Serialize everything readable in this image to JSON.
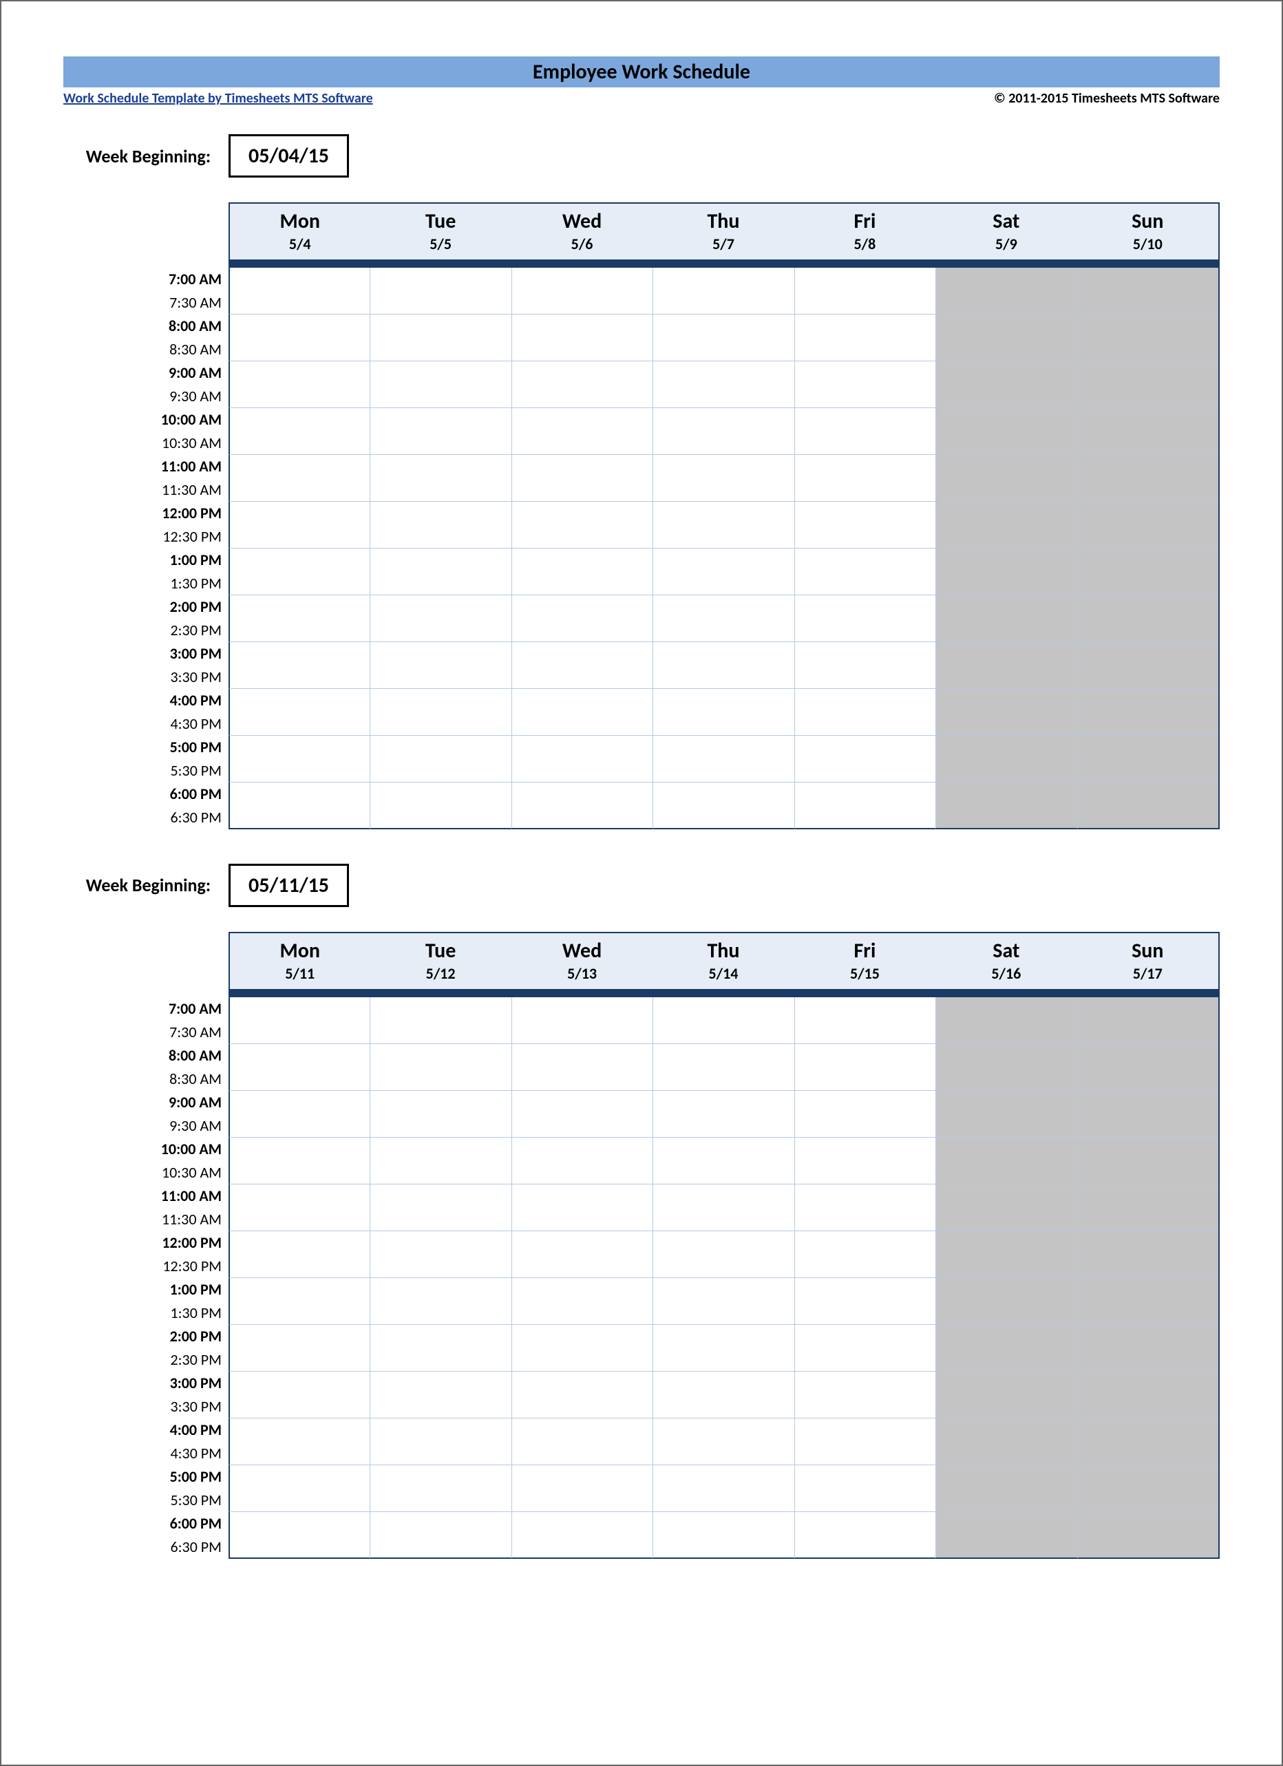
{
  "header": {
    "title": "Employee Work Schedule",
    "link_text": "Work Schedule Template by Timesheets MTS Software",
    "copyright": "© 2011-2015 Timesheets MTS Software"
  },
  "week_begin_label": "Week Beginning:",
  "weeks": [
    {
      "date": "05/04/15",
      "days": [
        {
          "name": "Mon",
          "date": "5/4",
          "weekend": false
        },
        {
          "name": "Tue",
          "date": "5/5",
          "weekend": false
        },
        {
          "name": "Wed",
          "date": "5/6",
          "weekend": false
        },
        {
          "name": "Thu",
          "date": "5/7",
          "weekend": false
        },
        {
          "name": "Fri",
          "date": "5/8",
          "weekend": false
        },
        {
          "name": "Sat",
          "date": "5/9",
          "weekend": true
        },
        {
          "name": "Sun",
          "date": "5/10",
          "weekend": true
        }
      ]
    },
    {
      "date": "05/11/15",
      "days": [
        {
          "name": "Mon",
          "date": "5/11",
          "weekend": false
        },
        {
          "name": "Tue",
          "date": "5/12",
          "weekend": false
        },
        {
          "name": "Wed",
          "date": "5/13",
          "weekend": false
        },
        {
          "name": "Thu",
          "date": "5/14",
          "weekend": false
        },
        {
          "name": "Fri",
          "date": "5/15",
          "weekend": false
        },
        {
          "name": "Sat",
          "date": "5/16",
          "weekend": true
        },
        {
          "name": "Sun",
          "date": "5/17",
          "weekend": true
        }
      ]
    }
  ],
  "times": [
    {
      "label": "7:00 AM",
      "hour": true
    },
    {
      "label": "7:30 AM",
      "hour": false
    },
    {
      "label": "8:00 AM",
      "hour": true
    },
    {
      "label": "8:30 AM",
      "hour": false
    },
    {
      "label": "9:00 AM",
      "hour": true
    },
    {
      "label": "9:30 AM",
      "hour": false
    },
    {
      "label": "10:00 AM",
      "hour": true
    },
    {
      "label": "10:30 AM",
      "hour": false
    },
    {
      "label": "11:00 AM",
      "hour": true
    },
    {
      "label": "11:30 AM",
      "hour": false
    },
    {
      "label": "12:00 PM",
      "hour": true
    },
    {
      "label": "12:30 PM",
      "hour": false
    },
    {
      "label": "1:00 PM",
      "hour": true
    },
    {
      "label": "1:30 PM",
      "hour": false
    },
    {
      "label": "2:00 PM",
      "hour": true
    },
    {
      "label": "2:30 PM",
      "hour": false
    },
    {
      "label": "3:00 PM",
      "hour": true
    },
    {
      "label": "3:30 PM",
      "hour": false
    },
    {
      "label": "4:00 PM",
      "hour": true
    },
    {
      "label": "4:30 PM",
      "hour": false
    },
    {
      "label": "5:00 PM",
      "hour": true
    },
    {
      "label": "5:30 PM",
      "hour": false
    },
    {
      "label": "6:00 PM",
      "hour": true
    },
    {
      "label": "6:30 PM",
      "hour": false
    }
  ]
}
